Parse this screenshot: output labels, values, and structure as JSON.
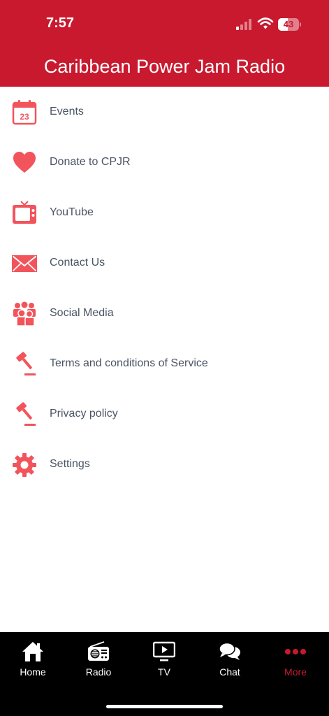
{
  "status_bar": {
    "time": "7:57",
    "battery_level": "43",
    "signal_bars_active": 1,
    "signal_bars_total": 4
  },
  "header": {
    "title": "Caribbean Power Jam Radio",
    "background_color": "#c8192f"
  },
  "menu": {
    "accent_color": "#f2545b",
    "items": [
      {
        "label": "Events",
        "icon": "calendar-icon",
        "icon_text": "23"
      },
      {
        "label": "Donate to CPJR",
        "icon": "heart-icon"
      },
      {
        "label": "YouTube",
        "icon": "tv-icon"
      },
      {
        "label": "Contact Us",
        "icon": "envelope-icon"
      },
      {
        "label": "Social Media",
        "icon": "people-icon"
      },
      {
        "label": "Terms and conditions of Service",
        "icon": "gavel-icon"
      },
      {
        "label": "Privacy policy",
        "icon": "gavel-icon"
      },
      {
        "label": "Settings",
        "icon": "gear-icon"
      }
    ]
  },
  "tab_bar": {
    "active_color": "#c8192f",
    "tabs": [
      {
        "label": "Home",
        "icon": "home-icon",
        "active": false
      },
      {
        "label": "Radio",
        "icon": "radio-icon",
        "active": false
      },
      {
        "label": "TV",
        "icon": "tv-play-icon",
        "active": false
      },
      {
        "label": "Chat",
        "icon": "chat-icon",
        "active": false
      },
      {
        "label": "More",
        "icon": "more-icon",
        "active": true
      }
    ]
  }
}
